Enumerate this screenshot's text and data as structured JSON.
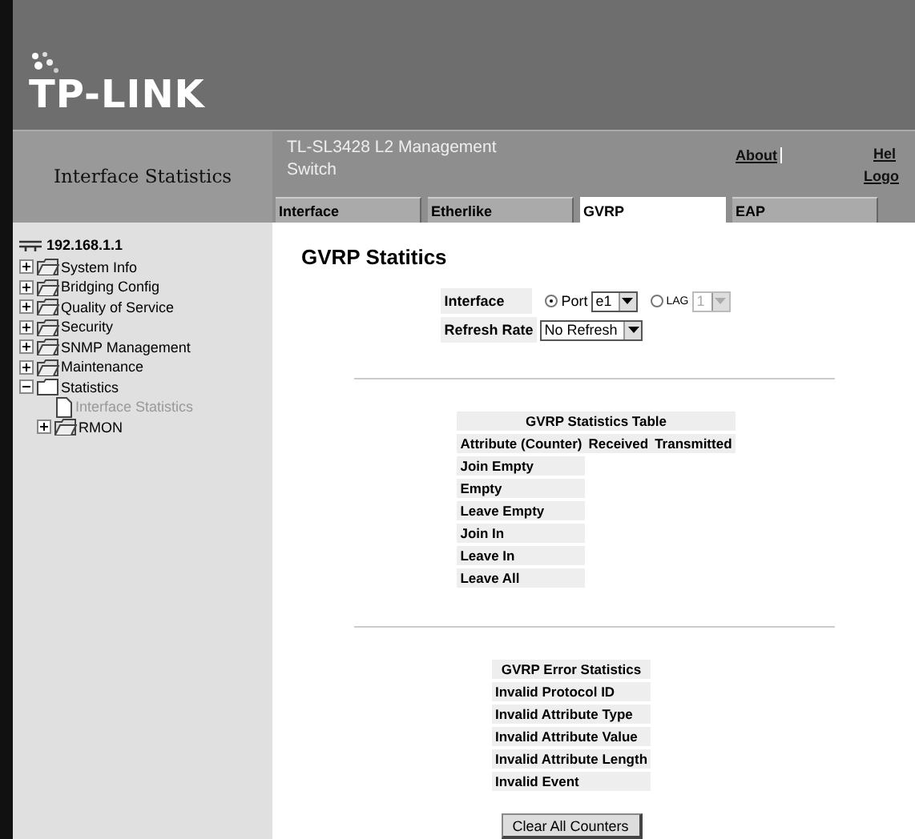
{
  "logo": {
    "text": "TP-LINK"
  },
  "page_title": "Interface Statistics",
  "product": "TL-SL3428 L2 Management Switch",
  "header_links": [
    {
      "label": "About"
    },
    {
      "label": "Hel"
    },
    {
      "label": "Logo"
    }
  ],
  "tabs": [
    {
      "label": "Interface",
      "selected": false
    },
    {
      "label": "Etherlike",
      "selected": false
    },
    {
      "label": "GVRP",
      "selected": true
    },
    {
      "label": "EAP",
      "selected": false
    }
  ],
  "tree": {
    "root": "192.168.1.1",
    "items": [
      {
        "label": "System Info",
        "expanded": false
      },
      {
        "label": "Bridging Config",
        "expanded": false
      },
      {
        "label": "Quality of Service",
        "expanded": false
      },
      {
        "label": "Security",
        "expanded": false
      },
      {
        "label": "SNMP Management",
        "expanded": false
      },
      {
        "label": "Maintenance",
        "expanded": false
      },
      {
        "label": "Statistics",
        "expanded": true,
        "children": [
          {
            "label": "Interface Statistics",
            "kind": "page",
            "selected": true
          },
          {
            "label": "RMON",
            "kind": "folder",
            "expanded": false,
            "selected": false
          }
        ]
      }
    ]
  },
  "heading": "GVRP Statitics",
  "form": {
    "interface_label": "Interface",
    "options": [
      {
        "label": "Port",
        "selected": true,
        "value": "e1",
        "disabled": false
      },
      {
        "label": "LAG",
        "selected": false,
        "value": "1",
        "disabled": true
      }
    ],
    "refresh_label": "Refresh Rate",
    "refresh_value": "No Refresh"
  },
  "stats_table": {
    "title": "GVRP Statistics Table",
    "columns": [
      "Attribute (Counter)",
      "Received",
      "Transmitted"
    ],
    "rows": [
      "Join Empty",
      "Empty",
      "Leave Empty",
      "Join In",
      "Leave In",
      "Leave All"
    ]
  },
  "error_table": {
    "title": "GVRP Error Statistics",
    "rows": [
      "Invalid Protocol ID",
      "Invalid Attribute Type",
      "Invalid Attribute Value",
      "Invalid Attribute Length",
      "Invalid Event"
    ]
  },
  "clear_button": "Clear All Counters"
}
